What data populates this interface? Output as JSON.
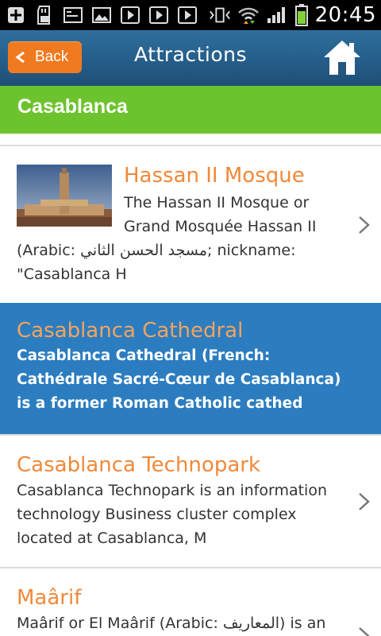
{
  "status_bar": {
    "time": "20:45",
    "icons": [
      "add-icon",
      "sd-card-icon",
      "terminal-icon",
      "image-icon",
      "play-icon",
      "play-icon",
      "play-icon",
      "vibrate-icon",
      "wifi-icon",
      "signal-icon",
      "battery-icon"
    ]
  },
  "header": {
    "back_label": "Back",
    "title": "Attractions"
  },
  "city": "Casablanca",
  "items": [
    {
      "name": "Hassan II Mosque",
      "desc_a": "The Hassan II Mosque or Grand Mosquée Hassan II",
      "desc_b": "(Arabic: مسجد الحسن الثاني; nickname: \"Casablanca H"
    },
    {
      "name": "Casablanca Cathedral",
      "desc": "Casablanca Cathedral (French: Cathédrale Sacré-Cœur de Casablanca) is a former Roman Catholic cathed"
    },
    {
      "name": "Casablanca Technopark",
      "desc": "Casablanca Technopark is an information technology Business cluster complex located at Casablanca, M"
    },
    {
      "name": "Maârif",
      "desc": "Maârif or El Maârif (Arabic: المعاريف) is an"
    }
  ],
  "colors": {
    "header": "#2a6591",
    "back_button": "#f07a1f",
    "city_bar": "#6dc32e",
    "item_name": "#f0893a",
    "selected_row": "#2c7dbf"
  }
}
